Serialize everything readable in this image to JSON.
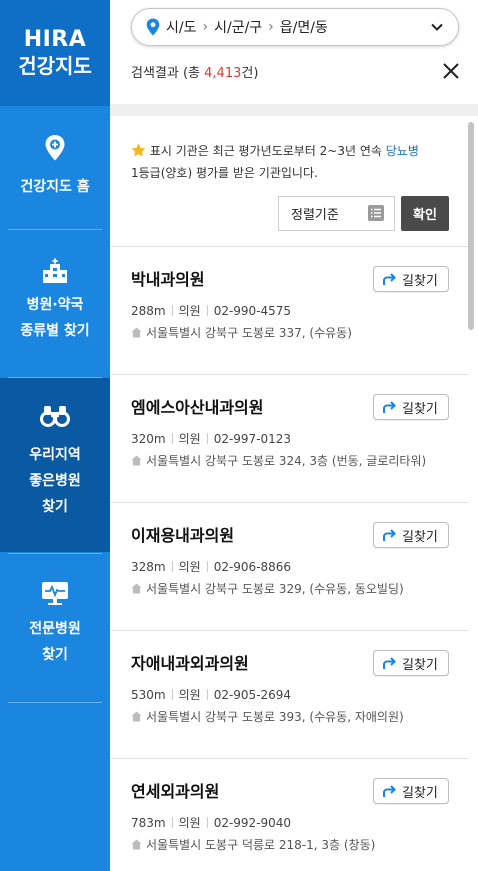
{
  "brand": {
    "line1": "HIRA",
    "line2": "건강지도"
  },
  "sidebar": {
    "items": [
      {
        "label1": "건강지도 홈",
        "label2": "",
        "label3": "",
        "icon": "map-pin-plus-icon"
      },
      {
        "label1": "병원·약국",
        "label2": "종류별 찾기",
        "label3": "",
        "icon": "hospital-building-icon"
      },
      {
        "label1": "우리지역",
        "label2": "좋은병원",
        "label3": "찾기",
        "icon": "binoculars-icon",
        "active": true
      },
      {
        "label1": "전문병원",
        "label2": "찾기",
        "label3": "",
        "icon": "monitor-heartbeat-icon"
      }
    ]
  },
  "region": {
    "sido": "시/도",
    "sigungu": "시/군/구",
    "dong": "읍/면/동"
  },
  "result": {
    "prefix": "검색결과 (총 ",
    "count": "4,413",
    "suffix": "건)"
  },
  "notice": {
    "part1": "표시 기관은 최근 평가년도로부터 2~3년 연속 ",
    "highlight": "당뇨병",
    "part2": "1등급(양호) 평가를 받은 기관입니다."
  },
  "sort": {
    "label": "정렬기준",
    "confirm": "확인"
  },
  "directions_label": "길찾기",
  "hospitals": [
    {
      "name": "박내과의원",
      "distance": "288m",
      "type": "의원",
      "phone": "02-990-4575",
      "address": "서울특별시 강북구 도봉로 337, (수유동)"
    },
    {
      "name": "엠에스아산내과의원",
      "distance": "320m",
      "type": "의원",
      "phone": "02-997-0123",
      "address": "서울특별시 강북구 도봉로 324, 3층 (번동, 글로리타워)"
    },
    {
      "name": "이재용내과의원",
      "distance": "328m",
      "type": "의원",
      "phone": "02-906-8866",
      "address": "서울특별시 강북구 도봉로 329, (수유동, 동오빌딩)"
    },
    {
      "name": "자애내과외과의원",
      "distance": "530m",
      "type": "의원",
      "phone": "02-905-2694",
      "address": "서울특별시 강북구 도봉로 393, (수유동, 자애의원)"
    },
    {
      "name": "연세외과의원",
      "distance": "783m",
      "type": "의원",
      "phone": "02-992-9040",
      "address": "서울특별시 도봉구 덕릉로 218-1, 3층 (창동)"
    }
  ],
  "colors": {
    "sidebar": "#1a86e0",
    "brand": "#0f6fc6",
    "active": "#0a5aa3",
    "count": "#e2392e",
    "highlight": "#1a73c8"
  }
}
